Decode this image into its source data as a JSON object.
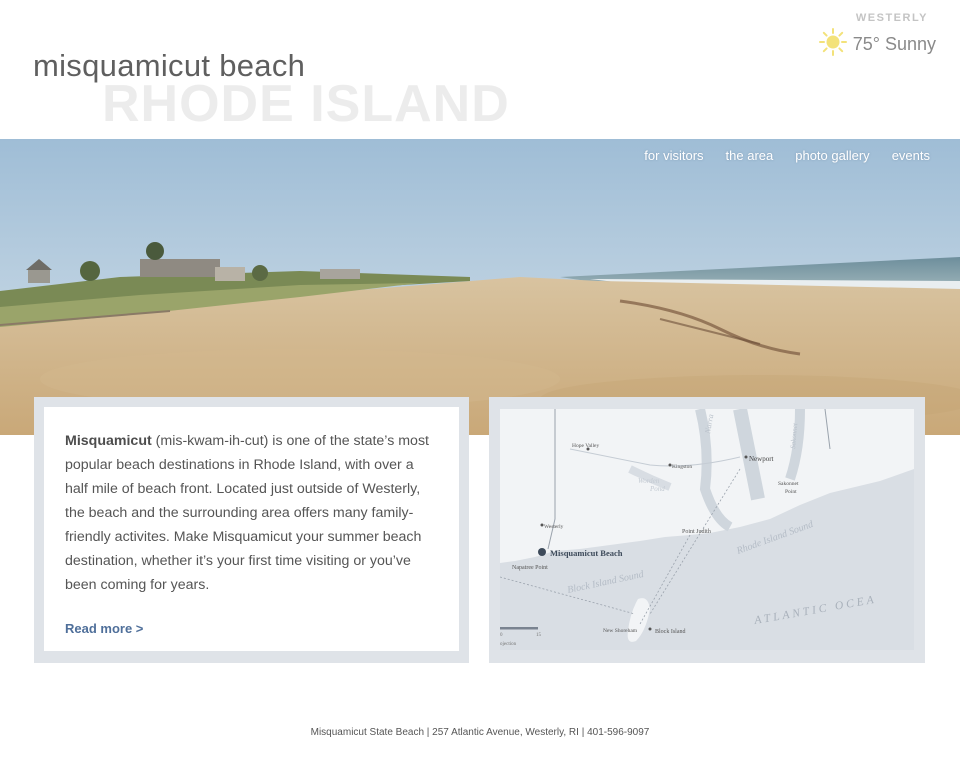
{
  "site": {
    "title": "misquamicut beach",
    "watermark": "RHODE ISLAND"
  },
  "weather": {
    "city": "WESTERLY",
    "temp": "75° Sunny",
    "icon": "sun-icon"
  },
  "nav": {
    "items": [
      "for visitors",
      "the area",
      "photo gallery",
      "events"
    ]
  },
  "intro": {
    "bold": "Misquamicut",
    "text": " (mis-kwam-ih-cut) is one of the state’s most popular beach destinations in Rhode Island, with over a half mile of beach front. Located just outside of Westerly,  the beach and the surrounding area offers many family-friendly activites. Make Misquamicut your summer beach destination, whether it’s your first time visiting or you’ve been coming for years.",
    "read_more": "Read more >"
  },
  "map": {
    "labels": {
      "hope_valley": "Hope Valley",
      "kingston": "Kingston",
      "worden": "Worden",
      "pond": "Pond",
      "newport": "Newport",
      "narra": "Narra",
      "sakonnet": "Sakonnet",
      "sakonnet_point": "Sakonnet",
      "point": "Point",
      "westerly": "Westerly",
      "point_judith": "Point Judith",
      "misquamicut": "Misquamicut Beach",
      "napatree": "Napatree Point",
      "ri_sound": "Rhode Island Sound",
      "bi_sound": "Block Island Sound",
      "new_shoreham": "New Shoreham",
      "block_island": "Block Island",
      "atlantic": "ATLANTIC  OCEA",
      "scale_0": "0",
      "scale_15": "15",
      "projection": "ojection"
    },
    "colors": {
      "water": "#d9dee4",
      "land": "#f2f4f6",
      "marker": "#3d4a5a"
    }
  },
  "footer": {
    "text": "Misquamicut State Beach  |  257 Atlantic Avenue, Westerly, RI  |  401-596-9097"
  }
}
